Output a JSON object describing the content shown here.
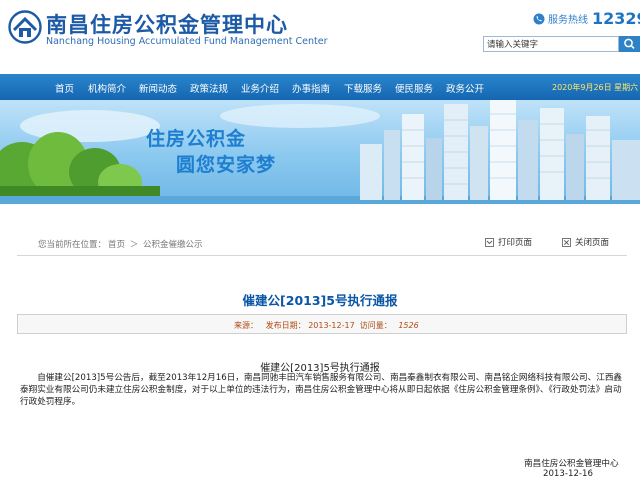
{
  "header": {
    "title": "南昌住房公积金管理中心",
    "subtitle": "Nanchang Housing Accumulated Fund Management Center",
    "hotline_label": "服务热线",
    "hotline_number": "12329",
    "search_placeholder": "请输入关键字",
    "search_value": "请输入关键字"
  },
  "nav": {
    "items": [
      {
        "label": "首页"
      },
      {
        "label": "机构简介"
      },
      {
        "label": "新闻动态"
      },
      {
        "label": "政策法规"
      },
      {
        "label": "业务介绍"
      },
      {
        "label": "办事指南"
      },
      {
        "label": "下载服务"
      },
      {
        "label": "便民服务"
      },
      {
        "label": "政务公开"
      }
    ],
    "date": "2020年9月26日 星期六"
  },
  "banner": {
    "slogan1": "住房公积金",
    "slogan2": "圆您安家梦"
  },
  "breadcrumb": {
    "prefix": "您当前所在位置：",
    "home": "首页",
    "sep": "＞",
    "current": "公积金催缴公示"
  },
  "tools": {
    "print_label": "打印页面",
    "close_label": "关闭页面"
  },
  "article": {
    "title": "催建公[2013]5号执行通报",
    "meta_source": "来源：",
    "meta_date_label": "发布日期：",
    "meta_date": "2013-12-17",
    "meta_views_label": "访问量：",
    "meta_views": "1526",
    "body_title": "催建公[2013]5号执行通报",
    "body_paragraph": "自催建公[2013]5号公告后，截至2013年12月16日，南昌同驰丰田汽车销售服务有限公司、南昌秦鑫制衣有限公司、南昌铭企网络科技有限公司、江西鑫泰翔实业有限公司仍未建立住房公积金制度，对于以上单位的违法行为，南昌住房公积金管理中心将从即日起依据《住房公积金管理条例》、《行政处罚法》启动行政处罚程序。",
    "sign_org": "南昌住房公积金管理中心",
    "sign_date": "2013-12-16"
  },
  "colors": {
    "brand_blue": "#1c5aa6",
    "nav_blue": "#1566b2",
    "title_blue": "#0b56a6",
    "meta_text": "#b04b15",
    "date_yellow": "#ffe66b"
  }
}
